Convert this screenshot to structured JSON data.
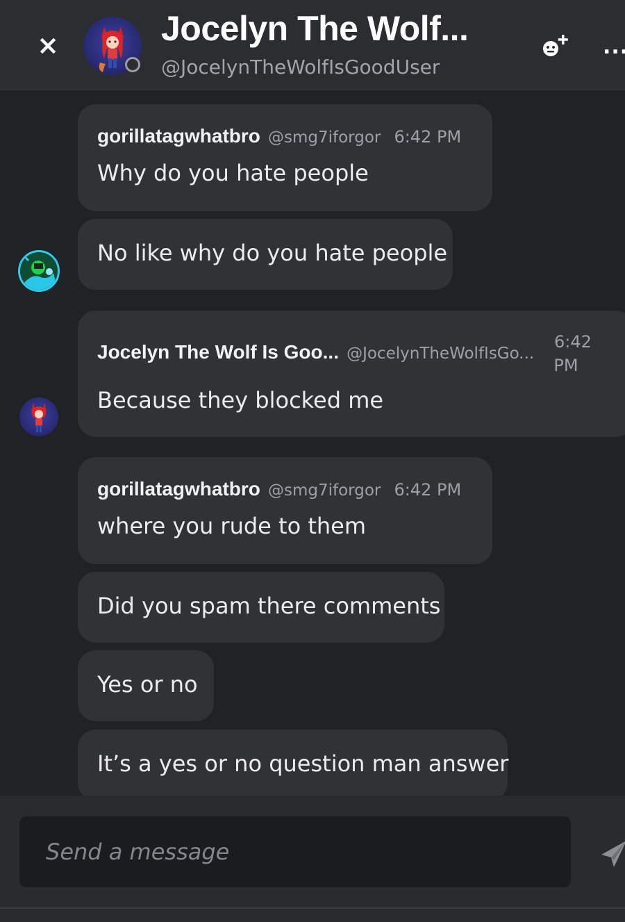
{
  "header": {
    "close_label": "×",
    "title": "Jocelyn The Wolf...",
    "handle": "@JocelynTheWolfIsGoodUser",
    "more_label": "..."
  },
  "messages": [
    {
      "author": "gorillatagwhatbro",
      "handle": "@smg7iforgor",
      "time": "6:42 PM",
      "text": "Why do you hate people"
    },
    {
      "text": "No like why do you hate people"
    },
    {
      "author": "Jocelyn The Wolf Is Goo...",
      "handle": "@JocelynTheWolfIsGo...",
      "time_line1": "6:42",
      "time_line2": "PM",
      "text": "Because they blocked me"
    },
    {
      "author": "gorillatagwhatbro",
      "handle": "@smg7iforgor",
      "time": "6:42 PM",
      "text": "where you rude to them"
    },
    {
      "text": "Did you spam there comments"
    },
    {
      "text": "Yes or no"
    },
    {
      "text": "It’s a yes or no question man answer"
    }
  ],
  "composer": {
    "placeholder": "Send a message"
  },
  "colors": {
    "background": "#212225",
    "header": "#2c2d30",
    "bubble": "#313236",
    "composer": "#1b1c1f"
  },
  "icons": [
    "close-icon",
    "add-friend-icon",
    "more-icon",
    "send-icon"
  ]
}
